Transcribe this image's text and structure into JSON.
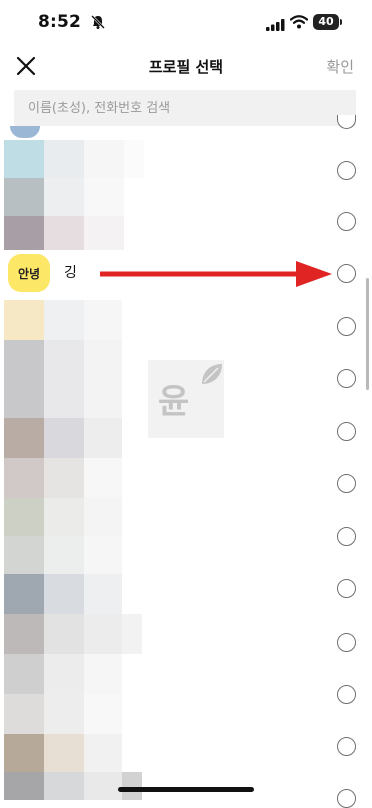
{
  "status_bar": {
    "time": "8:52",
    "battery": "40"
  },
  "header": {
    "title": "프로필 선택",
    "confirm_label": "확인"
  },
  "search": {
    "placeholder": "이름(초성), 전화번호 검색"
  },
  "selected_row": {
    "badge": "안녕",
    "name": "깅"
  },
  "watermark": {
    "text": "윤"
  },
  "colors": {
    "accent_yellow": "#fde767",
    "arrow_red": "#e02424",
    "radio_border": "#6f6f6f"
  },
  "icons": [
    "close-icon",
    "bell-slash-icon",
    "signal-icon",
    "wifi-icon",
    "battery-icon",
    "leaf-icon",
    "red-arrow"
  ]
}
